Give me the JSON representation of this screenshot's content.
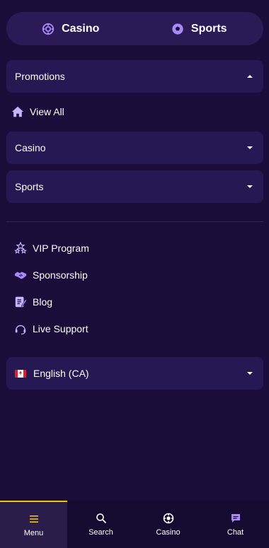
{
  "top_switch": {
    "casino_label": "Casino",
    "sports_label": "Sports"
  },
  "menu": {
    "promotions_label": "Promotions",
    "view_all_label": "View All",
    "casino_label": "Casino",
    "sports_label": "Sports"
  },
  "links": [
    {
      "label": "VIP Program",
      "icon": "stars-icon"
    },
    {
      "label": "Sponsorship",
      "icon": "handshake-icon"
    },
    {
      "label": "Blog",
      "icon": "blog-icon"
    },
    {
      "label": "Live Support",
      "icon": "headset-icon"
    }
  ],
  "language": {
    "label": "English (CA)",
    "flag": "canada-flag-icon"
  },
  "bottom_nav": {
    "items": [
      {
        "label": "Menu",
        "icon": "menu-icon",
        "active": true
      },
      {
        "label": "Search",
        "icon": "search-icon",
        "active": false
      },
      {
        "label": "Casino",
        "icon": "casino-chip-icon",
        "active": false
      },
      {
        "label": "Chat",
        "icon": "chat-icon",
        "active": false
      }
    ]
  },
  "colors": {
    "background": "#1a0d3a",
    "panel": "#261852",
    "accent_purple": "#a78bfa",
    "active_indicator": "#f4c400"
  }
}
